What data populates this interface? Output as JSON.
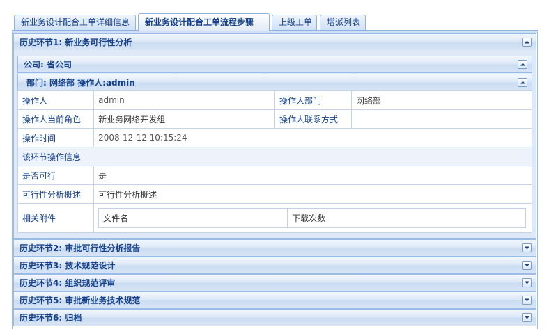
{
  "tabs": [
    {
      "label": "新业务设计配合工单详细信息",
      "active": false
    },
    {
      "label": "新业务设计配合工单流程步骤",
      "active": true
    },
    {
      "label": "上级工单",
      "active": false
    },
    {
      "label": "增派列表",
      "active": false
    }
  ],
  "history": [
    {
      "label": "历史环节1: 新业务可行性分析",
      "expanded": true
    },
    {
      "label": "历史环节2: 审批可行性分析报告",
      "expanded": false
    },
    {
      "label": "历史环节3: 技术规范设计",
      "expanded": false
    },
    {
      "label": "历史环节4: 组织规范评审",
      "expanded": false
    },
    {
      "label": "历史环节5: 审批新业务技术规范",
      "expanded": false
    },
    {
      "label": "历史环节6: 归档",
      "expanded": false
    }
  ],
  "company_header": "公司: 省公司",
  "dept_header": "部门: 网络部  操作人:admin",
  "details": {
    "operator_label": "操作人",
    "operator": "admin",
    "operator_dept_label": "操作人部门",
    "operator_dept": "网络部",
    "role_label": "操作人当前角色",
    "role": "新业务网络开发组",
    "contact_label": "操作人联系方式",
    "contact": "",
    "time_label": "操作时间",
    "time": "2008-12-12 10:15:24",
    "step_info_label": "该环节操作信息",
    "feasible_label": "是否可行",
    "feasible": "是",
    "summary_label": "可行性分析概述",
    "summary": "可行性分析概述",
    "attachments_label": "相关附件",
    "attach_col_name": "文件名",
    "attach_col_downloads": "下载次数"
  }
}
